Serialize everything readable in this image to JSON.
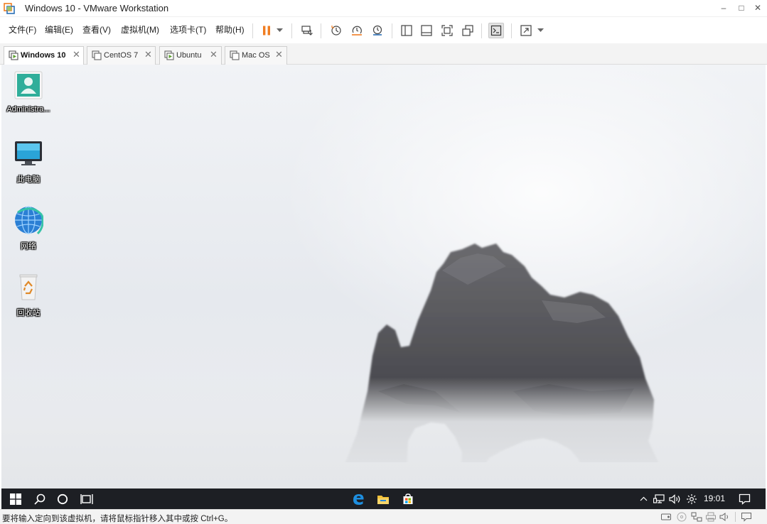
{
  "window": {
    "title": "Windows 10 - VMware Workstation",
    "minimize_glyph": "–",
    "maximize_glyph": "□",
    "close_glyph": "✕"
  },
  "menu": [
    {
      "label": "文件(F)"
    },
    {
      "label": "编辑(E)"
    },
    {
      "label": "查看(V)"
    },
    {
      "label": "虚拟机(M)"
    },
    {
      "label": "选项卡(T)"
    },
    {
      "label": "帮助(H)"
    }
  ],
  "toolbar": {
    "icons": [
      "pause-icon",
      "dropdown-arrow-icon",
      "send-ctrl-alt-del-icon",
      "snapshot-take-icon",
      "snapshot-revert-icon",
      "snapshot-manager-icon",
      "library-view-icon",
      "thumbnail-bar-icon",
      "full-screen-icon",
      "unity-icon",
      "console-view-icon",
      "stretch-guest-icon",
      "dropdown-arrow-icon"
    ],
    "accent_color": "#f07d21"
  },
  "tabs": [
    {
      "label": "Windows 10",
      "active": true
    },
    {
      "label": "CentOS 7",
      "active": false
    },
    {
      "label": "Ubuntu",
      "active": false
    },
    {
      "label": "Mac OS",
      "active": false
    }
  ],
  "tab_close_glyph": "✕",
  "desktop": {
    "icons": [
      {
        "label": "Administra...",
        "icon": "user-folder-icon"
      },
      {
        "label": "此电脑",
        "icon": "this-pc-icon"
      },
      {
        "label": "网络",
        "icon": "network-icon"
      },
      {
        "label": "回收站",
        "icon": "recycle-bin-icon"
      }
    ]
  },
  "taskbar": {
    "left_icons": [
      "windows-start-icon",
      "search-icon",
      "cortana-icon",
      "task-view-icon"
    ],
    "pinned_icons": [
      "edge-icon",
      "file-explorer-icon",
      "store-icon"
    ],
    "tray_icons": [
      "tray-overflow-icon",
      "network-tray-icon",
      "volume-icon",
      "input-method-icon"
    ],
    "clock": "19:01",
    "notification_icon": "action-center-icon"
  },
  "statusbar": {
    "message": "要将输入定向到该虚拟机，请将鼠标指针移入其中或按 Ctrl+G。",
    "device_icons": [
      "hard-disk-icon",
      "cd-dvd-icon",
      "network-adapter-icon",
      "printer-icon",
      "sound-icon",
      "message-log-icon"
    ]
  }
}
